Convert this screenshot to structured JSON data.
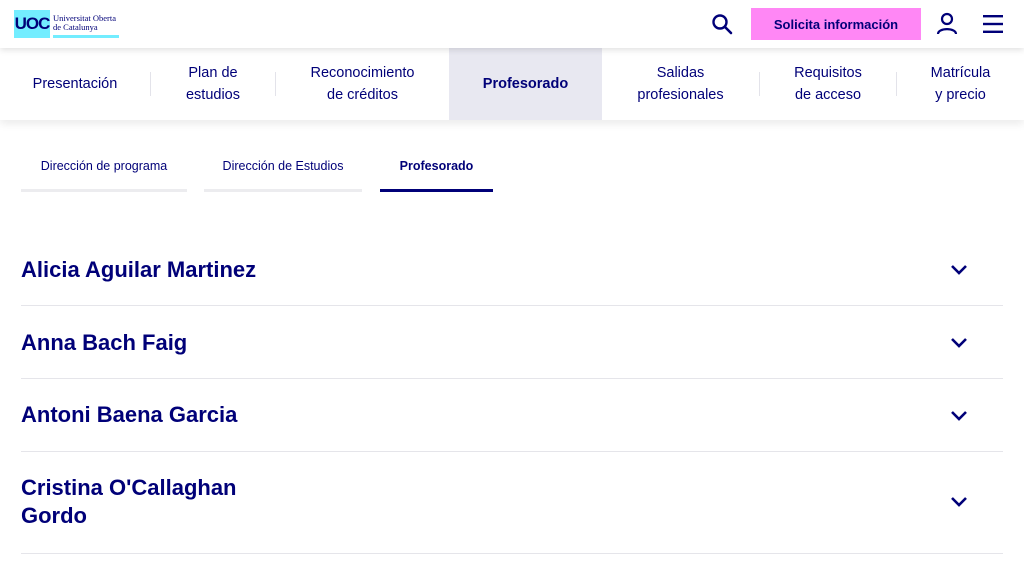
{
  "header": {
    "logo_mark": "UOC",
    "logo_line1": "Universitat Oberta",
    "logo_line2": "de Catalunya",
    "search_icon": "search-icon",
    "cta_label": "Solicita información",
    "user_icon": "user-icon",
    "menu_icon": "hamburger-menu-icon",
    "colors": {
      "brand": "#000078",
      "cta": "#ff87f5",
      "logo": "#73edff"
    }
  },
  "nav": {
    "items": [
      {
        "label": "Presentación"
      },
      {
        "label": "Plan de\nestudios"
      },
      {
        "label": "Reconocimiento\nde créditos"
      },
      {
        "label": "Profesorado",
        "active": true
      },
      {
        "label": "Salidas\nprofesionales"
      },
      {
        "label": "Requisitos\nde acceso"
      },
      {
        "label": "Matrícula\ny precio"
      }
    ]
  },
  "subtabs": [
    {
      "label": "Dirección de programa"
    },
    {
      "label": "Dirección de Estudios"
    },
    {
      "label": "Profesorado",
      "active": true
    }
  ],
  "faculty": [
    {
      "name": "Alicia Aguilar Martinez"
    },
    {
      "name": "Anna Bach Faig"
    },
    {
      "name": "Antoni Baena Garcia"
    },
    {
      "name": "Cristina O'Callaghan\nGordo"
    }
  ]
}
